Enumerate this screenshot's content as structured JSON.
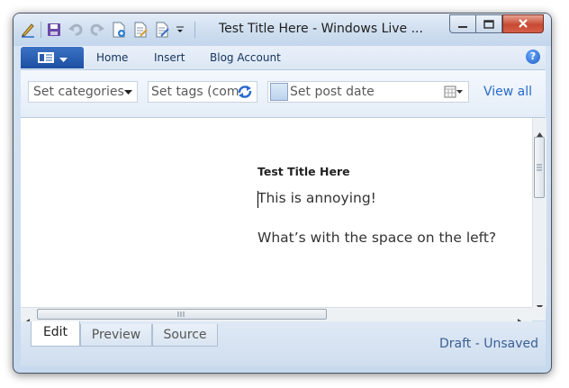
{
  "window": {
    "title": "Test Title Here - Windows Live ..."
  },
  "ribbon_tabs": [
    "Home",
    "Insert",
    "Blog Account"
  ],
  "fields": {
    "categories": "Set categories",
    "tags": "Set tags (com",
    "post_date": "Set post date",
    "view_all": "View all"
  },
  "post": {
    "title": "Test Title Here",
    "paragraphs": [
      "This is annoying!",
      "What’s with the space on the left?"
    ]
  },
  "view_tabs": [
    "Edit",
    "Preview",
    "Source"
  ],
  "active_view_tab": "Edit",
  "status": "Draft - Unsaved",
  "icons": [
    "pen-icon",
    "save-icon",
    "undo-icon",
    "redo-icon",
    "new-post-icon",
    "open-icon",
    "publish-icon",
    "qat-dropdown-icon",
    "minimize-icon",
    "maximize-icon",
    "close-icon",
    "app-menu-icon",
    "help-icon",
    "dropdown-icon",
    "tag-refresh-icon",
    "calendar-icon"
  ]
}
